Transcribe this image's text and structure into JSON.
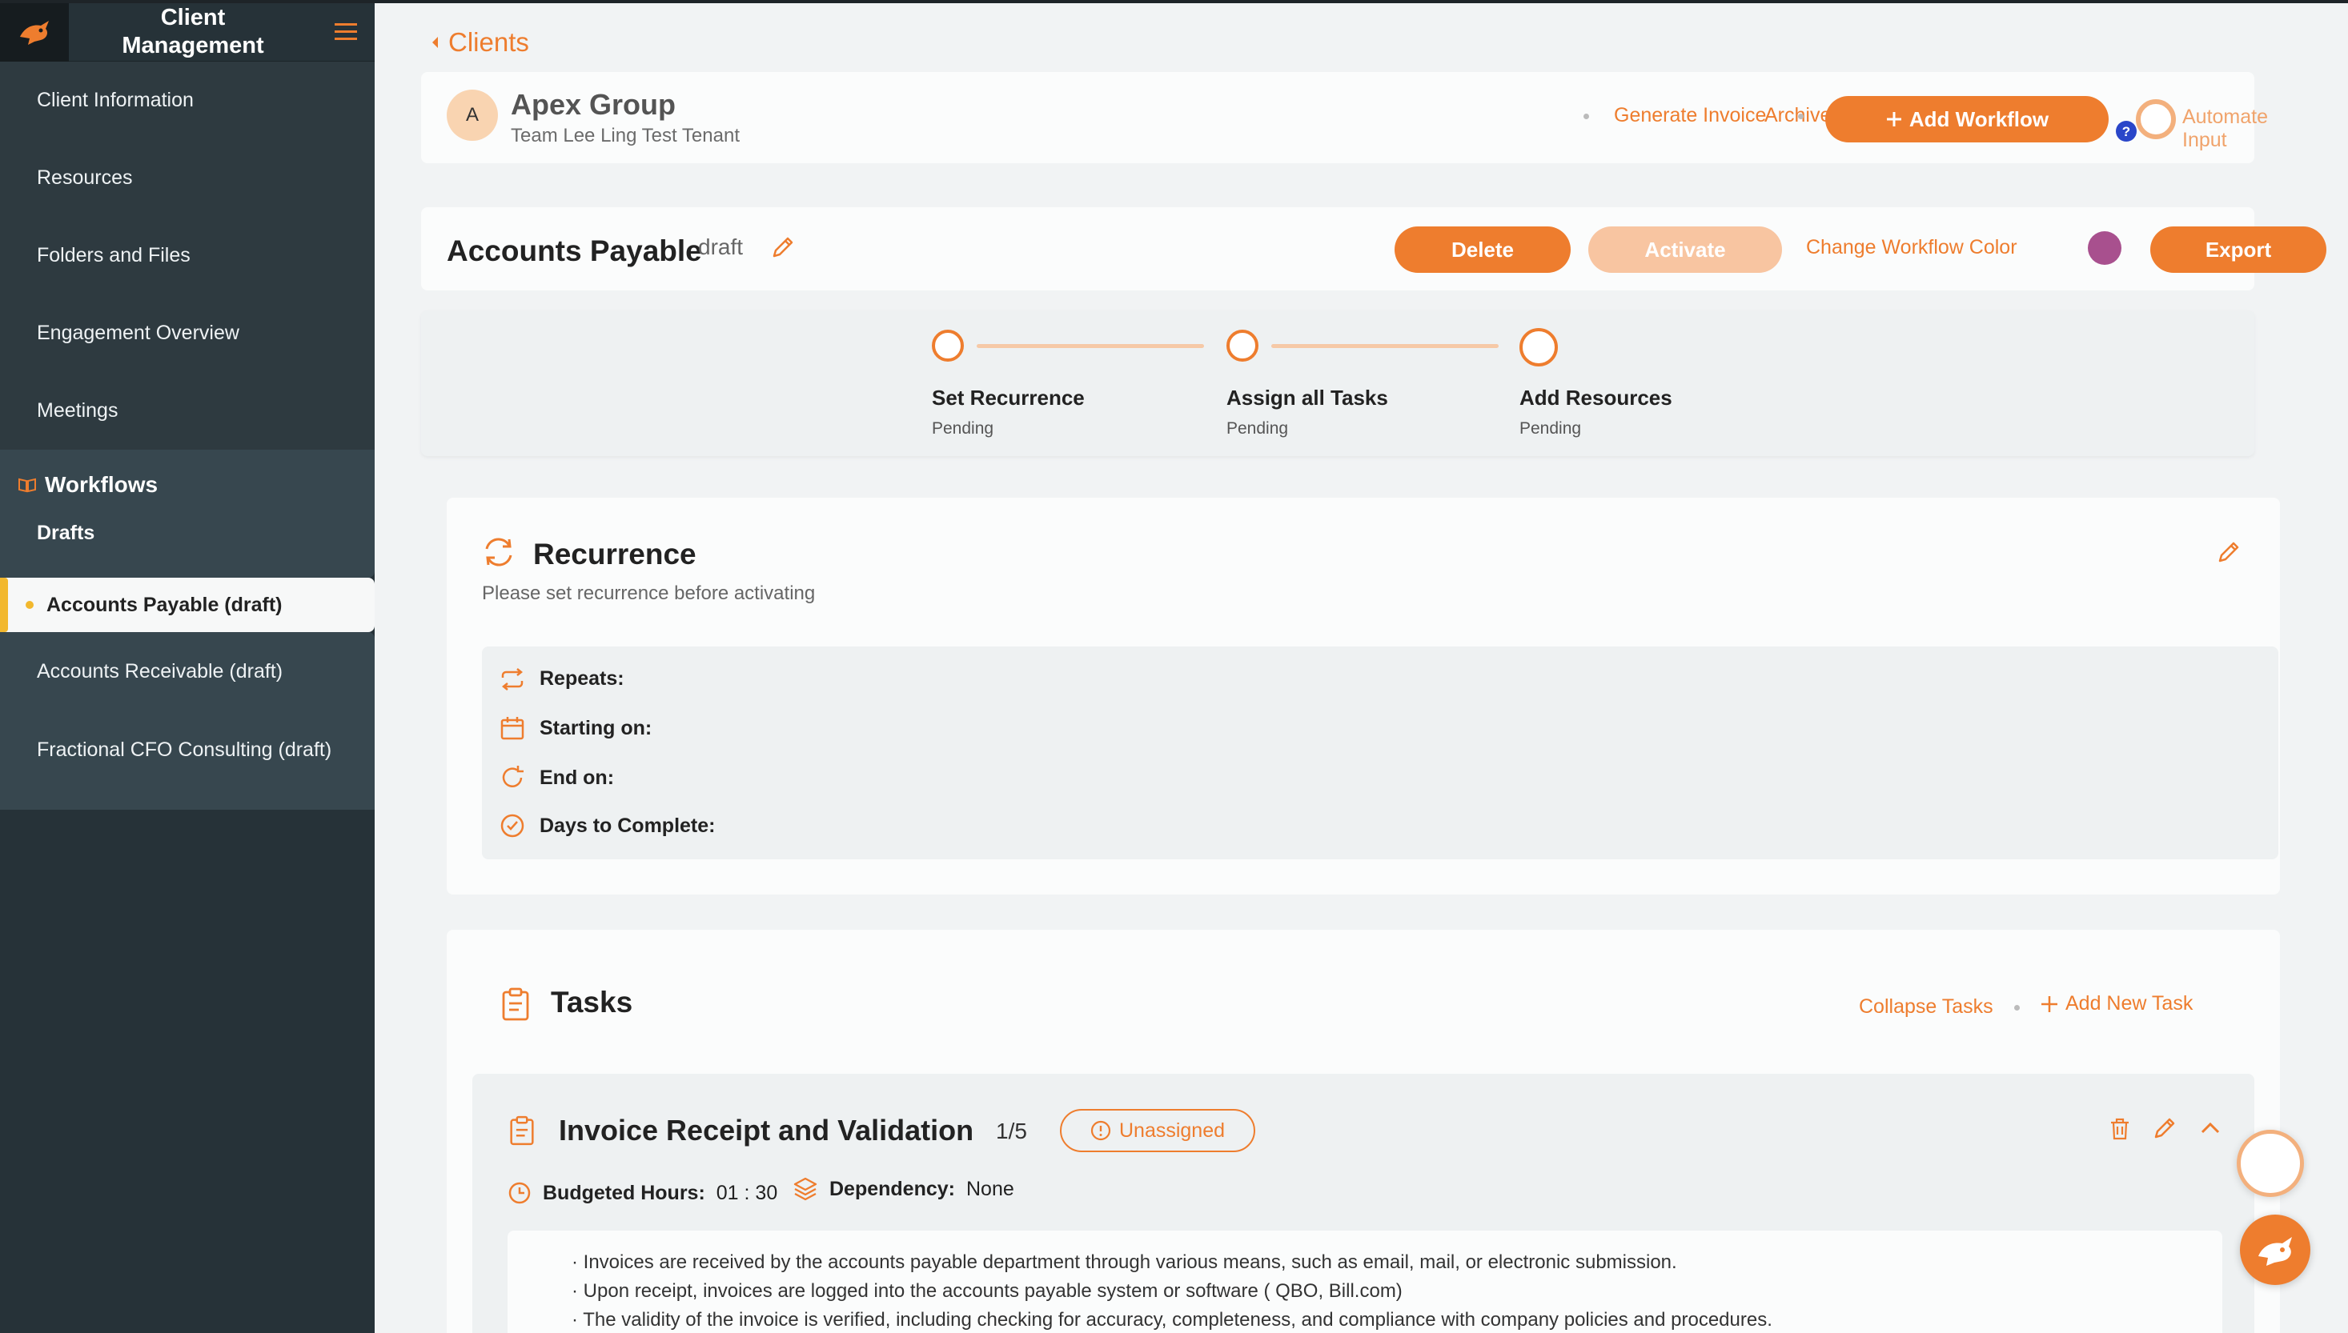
{
  "app": {
    "title_line1": "Client",
    "title_line2": "Management"
  },
  "sidebar": {
    "items": [
      {
        "label": "Client Information"
      },
      {
        "label": "Resources"
      },
      {
        "label": "Folders and Files"
      },
      {
        "label": "Engagement Overview"
      },
      {
        "label": "Meetings"
      }
    ],
    "workflows_label": "Workflows",
    "drafts_label": "Drafts",
    "active_item": "Accounts Payable (draft)",
    "draft_items": [
      {
        "label": "Accounts Receivable (draft)"
      },
      {
        "label": "Fractional CFO Consulting (draft)"
      }
    ]
  },
  "breadcrumb": {
    "back_label": "Clients"
  },
  "client": {
    "initial": "A",
    "name": "Apex Group",
    "tenant": "Team Lee Ling Test Tenant",
    "archive_label": "Archive Client",
    "invoice_label": "Generate Invoice",
    "add_workflow_label": "Add Workflow",
    "automate_label": "Automate Input"
  },
  "workflow": {
    "title": "Accounts Payable",
    "status": "draft",
    "delete_label": "Delete",
    "activate_label": "Activate",
    "color_label": "Change Workflow Color",
    "color": "#a8508e",
    "export_label": "Export"
  },
  "steps": [
    {
      "label": "Set Recurrence",
      "status": "Pending"
    },
    {
      "label": "Assign all Tasks",
      "status": "Pending"
    },
    {
      "label": "Add Resources",
      "status": "Pending"
    }
  ],
  "recurrence": {
    "title": "Recurrence",
    "subtitle": "Please set recurrence before activating",
    "repeats_label": "Repeats:",
    "starting_label": "Starting on:",
    "end_label": "End on:",
    "days_label": "Days to Complete:"
  },
  "tasks": {
    "title": "Tasks",
    "collapse_label": "Collapse Tasks",
    "add_label": "Add New Task",
    "items": [
      {
        "title": "Invoice Receipt and Validation",
        "count": "1/5",
        "assignee_status": "Unassigned",
        "budgeted_label": "Budgeted Hours:",
        "budgeted_value": "01 : 30",
        "dependency_label": "Dependency:",
        "dependency_value": "None",
        "description": [
          "· Invoices are received by the accounts payable department through various means, such as email, mail, or electronic submission.",
          "· Upon receipt, invoices are logged into the accounts payable system or software ( QBO, Bill.com)",
          "· The validity of the invoice is verified, including checking for accuracy, completeness, and compliance with company policies and procedures."
        ]
      }
    ]
  },
  "colors": {
    "accent": "#ee7d2e",
    "sidebar": "#263238",
    "active_marker": "#f2b82e"
  }
}
